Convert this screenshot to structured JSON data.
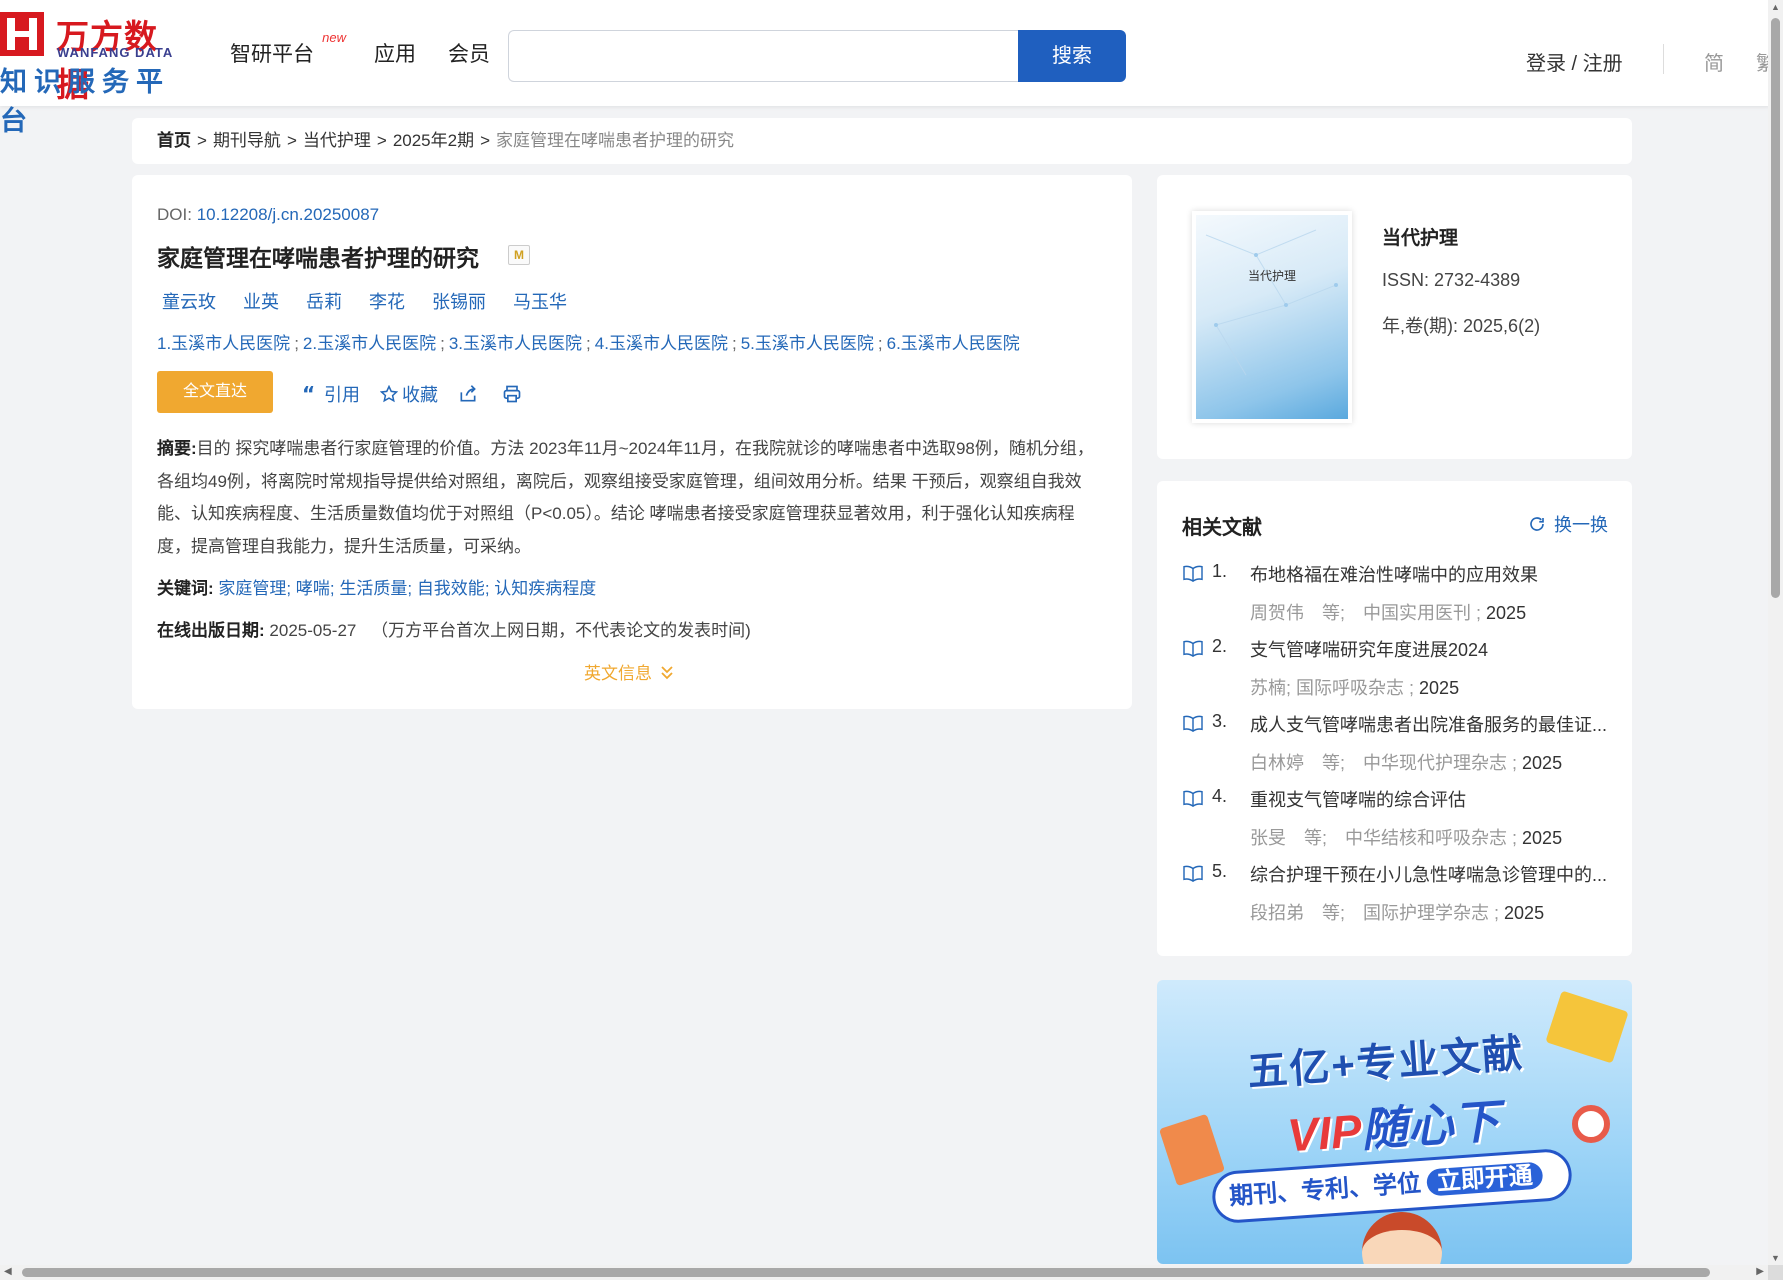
{
  "header": {
    "logo_cn": "万方数据",
    "logo_en": "WANFANG DATA",
    "logo_sub": "知识服务平台",
    "nav": [
      {
        "label": "智研平台",
        "badge": "new"
      },
      {
        "label": "应用"
      },
      {
        "label": "会员"
      }
    ],
    "search_value": "",
    "search_button": "搜索",
    "login": "登录 / 注册",
    "lang_simplified": "简",
    "lang_traditional": "繁"
  },
  "breadcrumb": {
    "items": [
      "首页",
      "期刊导航",
      "当代护理",
      "2025年2期"
    ],
    "current": "家庭管理在哮喘患者护理的研究",
    "separator": ">"
  },
  "article": {
    "doi_label": "DOI:",
    "doi": "10.12208/j.cn.20250087",
    "title": "家庭管理在哮喘患者护理的研究",
    "badge": "M",
    "authors": [
      "童云玫",
      "业英",
      "岳莉",
      "李花",
      "张锡丽",
      "马玉华"
    ],
    "orgs": [
      "1.玉溪市人民医院",
      "2.玉溪市人民医院",
      "3.玉溪市人民医院",
      "4.玉溪市人民医院",
      "5.玉溪市人民医院",
      "6.玉溪市人民医院"
    ],
    "org_separator": ";",
    "fulltext_button": "全文直达",
    "actions": {
      "cite": "引用",
      "collect": "收藏"
    },
    "abstract_label": "摘要:",
    "abstract": "目的 探究哮喘患者行家庭管理的价值。方法 2023年11月~2024年11月，在我院就诊的哮喘患者中选取98例，随机分组，各组均49例，将离院时常规指导提供给对照组，离院后，观察组接受家庭管理，组间效用分析。结果 干预后，观察组自我效能、认知疾病程度、生活质量数值均优于对照组（P<0.05）。结论 哮喘患者接受家庭管理获显著效用，利于强化认知疾病程度，提高管理自我能力，提升生活质量，可采纳。",
    "keywords_label": "关键词:",
    "keywords": [
      "家庭管理",
      "哮喘",
      "生活质量",
      "自我效能",
      "认知疾病程度"
    ],
    "keyword_separator": ";",
    "pubdate_label": "在线出版日期:",
    "pubdate": "2025-05-27",
    "pubdate_note": "（万方平台首次上网日期，不代表论文的发表时间)",
    "english_info": "英文信息"
  },
  "journal": {
    "cover_title": "当代护理",
    "name": "当代护理",
    "issn_label": "ISSN:",
    "issn": "2732-4389",
    "year_label": "年,卷(期):",
    "year": "2025,6(2)"
  },
  "related": {
    "title": "相关文献",
    "refresh": "换一换",
    "items": [
      {
        "num": "1.",
        "title": "布地格福在难治性哮喘中的应用效果",
        "meta": "周贺伟　等;　中国实用医刊 ;",
        "year": "2025"
      },
      {
        "num": "2.",
        "title": "支气管哮喘研究年度进展2024",
        "meta": "苏楠; 国际呼吸杂志 ;",
        "year": "2025"
      },
      {
        "num": "3.",
        "title": "成人支气管哮喘患者出院准备服务的最佳证...",
        "meta": "白林婷　等;　中华现代护理杂志 ;",
        "year": "2025"
      },
      {
        "num": "4.",
        "title": "重视支气管哮喘的综合评估",
        "meta": "张旻　等;　中华结核和呼吸杂志 ;",
        "year": "2025"
      },
      {
        "num": "5.",
        "title": "综合护理干预在小儿急性哮喘急诊管理中的...",
        "meta": "段招弟　等;　国际护理学杂志 ;",
        "year": "2025"
      }
    ]
  },
  "banner": {
    "line1": "五亿+专业文献",
    "line2_vip": "VIP",
    "line2_rest": "随心下",
    "pill_text": "期刊、专利、学位",
    "pill_cta": "立即开通"
  },
  "colors": {
    "brand_red": "#d7191f",
    "link_blue": "#2468b8",
    "search_blue": "#1f5fbf",
    "accent_orange": "#f0a830"
  }
}
